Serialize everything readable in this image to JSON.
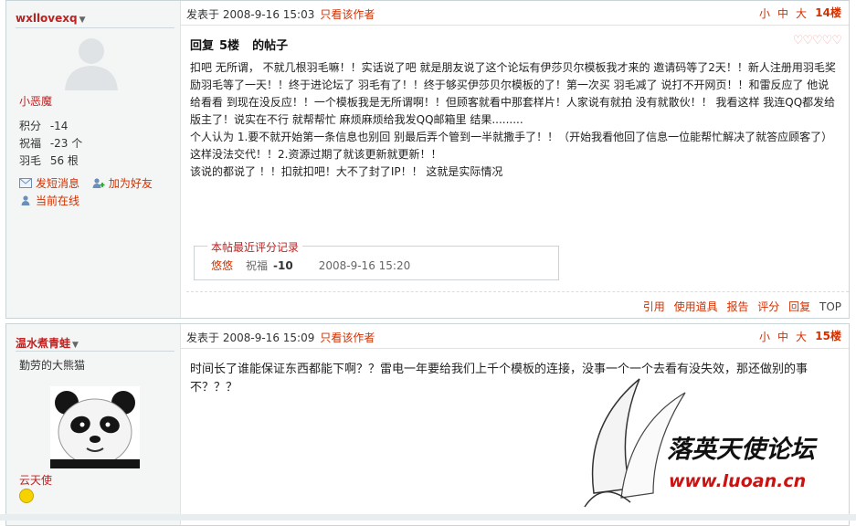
{
  "post1": {
    "username": "wxllovexq",
    "title": "小恶魔",
    "stats": [
      {
        "label": "积分",
        "value": "-14"
      },
      {
        "label": "祝福",
        "value": "-23 个"
      },
      {
        "label": "羽毛",
        "value": "56 根"
      }
    ],
    "actions": {
      "pm": "发短消息",
      "addfriend": "加为好友",
      "online": "当前在线"
    },
    "posted_label": "发表于",
    "posted_time": "2008-9-16 15:03",
    "only_author": "只看该作者",
    "font_sizes": [
      "小",
      "中",
      "大"
    ],
    "floor": "14楼",
    "reply_title": {
      "prefix": "回复",
      "floor": "5楼",
      "suffix": "的帖子"
    },
    "rating_stars": "♡♡♡♡♡",
    "paragraphs": [
      "扣吧 无所谓， 不就几根羽毛嘛！！实话说了吧 就是朋友说了这个论坛有伊莎贝尔模板我才来的 邀请码等了2天！！新人注册用羽毛奖励羽毛等了一天！！终于进论坛了 羽毛有了！！终于够买伊莎贝尔模板的了！第一次买 羽毛减了 说打不开网页！！和雷反应了 他说给看看 到现在没反应！！一个模板我是无所谓啊！！但顾客就看中那套样片！人家说有就拍 没有就散伙！！ 我看这样 我连QQ都发给版主了！说实在不行 就帮帮忙 麻烦麻烦给我发QQ邮箱里 结果.........",
      " 个人认为 1.要不就开始第一条信息也别回 别最后弄个管到一半就撒手了！！（开始我看他回了信息一位能帮忙解决了就答应顾客了）这样没法交代！！2.资源过期了就该更新就更新！！",
      "该说的都说了 ！！扣就扣吧！大不了封了IP！！ 这就是实际情况"
    ],
    "rating_box": {
      "legend": "本帖最近评分记录",
      "user": "悠悠",
      "field": "祝福",
      "value": "-10",
      "time": "2008-9-16 15:20"
    },
    "footer_links": [
      "引用",
      "使用道具",
      "报告",
      "评分",
      "回复",
      "TOP"
    ]
  },
  "post2": {
    "username": "温水煮青蛙",
    "title": "勤劳的大熊猫",
    "group": "云天使",
    "posted_label": "发表于",
    "posted_time": "2008-9-16 15:09",
    "only_author": "只看该作者",
    "font_sizes": [
      "小",
      "中",
      "大"
    ],
    "floor": "15楼",
    "body": "时间长了谁能保证东西都能下啊？？雷电一年要给我们上千个模板的连接，没事一个一个去看有没失效，那还做别的事不？？？"
  },
  "watermark": {
    "name": "落英天使论坛",
    "url": "www.luoan.cn"
  }
}
